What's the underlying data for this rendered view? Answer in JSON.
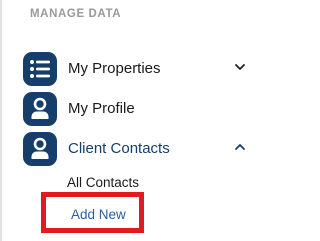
{
  "section": {
    "title": "MANAGE DATA"
  },
  "nav": {
    "items": [
      {
        "label": "My Properties",
        "icon": "list-icon",
        "expanded": false
      },
      {
        "label": "My Profile",
        "icon": "user-icon"
      },
      {
        "label": "Client Contacts",
        "icon": "user-icon",
        "expanded": true
      }
    ],
    "client_contacts_submenu": [
      {
        "label": "All Contacts"
      },
      {
        "label": "Add New",
        "highlighted": true
      }
    ]
  },
  "colors": {
    "icon_background": "#153e6b",
    "active_text": "#153e6b",
    "link_text": "#2b5f9e",
    "highlight_border": "#e21b23",
    "section_title": "#9a9a9a"
  }
}
